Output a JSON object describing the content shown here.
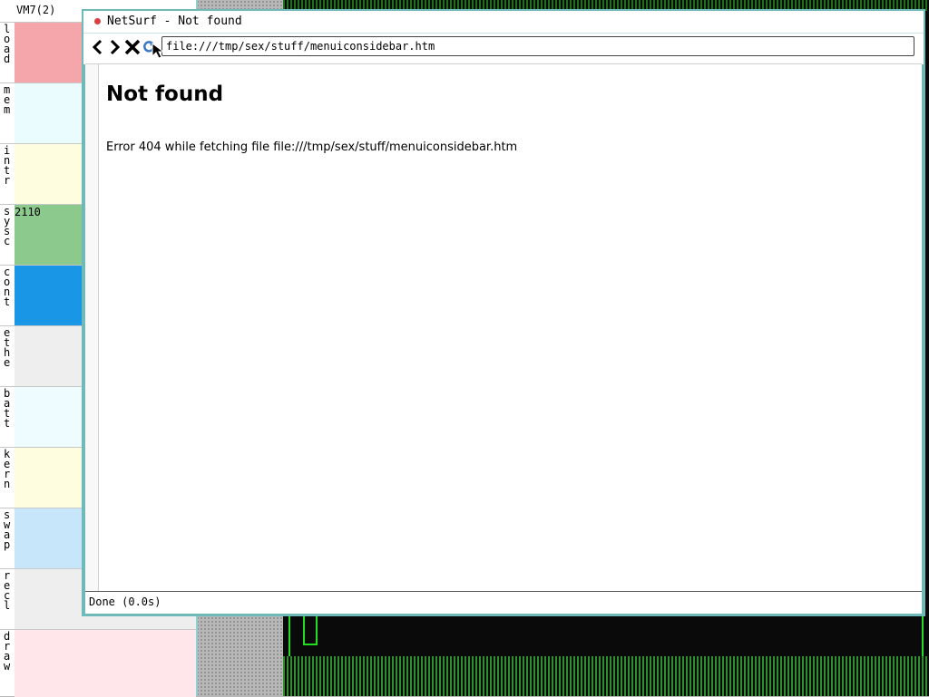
{
  "monitor": {
    "title": "VM7(2)",
    "rows": [
      {
        "label": "load",
        "color": "#f5a6ab",
        "value": ""
      },
      {
        "label": "mem",
        "color": "#eafcfe",
        "value": ""
      },
      {
        "label": "intr",
        "color": "#fffde0",
        "value": ""
      },
      {
        "label": "sysc",
        "color": "#8cc98c",
        "value": "2110"
      },
      {
        "label": "cont",
        "color": "#1997e6",
        "value": ""
      },
      {
        "label": "ethe",
        "color": "#eeeeee",
        "value": ""
      },
      {
        "label": "batt",
        "color": "#eefcff",
        "value": ""
      },
      {
        "label": "kern",
        "color": "#fffde0",
        "value": ""
      },
      {
        "label": "swap",
        "color": "#c8e6fa",
        "value": ""
      },
      {
        "label": "recl",
        "color": "#eeeeee",
        "value": ""
      },
      {
        "label": "draw",
        "color": "#ffe6ea",
        "value": ""
      }
    ]
  },
  "browser": {
    "window_title": "NetSurf - Not found",
    "toolbar": {
      "back_icon": "chevron-left-icon",
      "forward_icon": "chevron-right-icon",
      "stop_icon": "close-icon",
      "reload_icon": "reload-icon"
    },
    "url": "file:///tmp/sex/stuff/menuiconsidebar.htm",
    "page": {
      "heading": "Not found",
      "message": "Error 404 while fetching file file:///tmp/sex/stuff/menuiconsidebar.htm"
    },
    "status": "Done (0.0s)"
  }
}
